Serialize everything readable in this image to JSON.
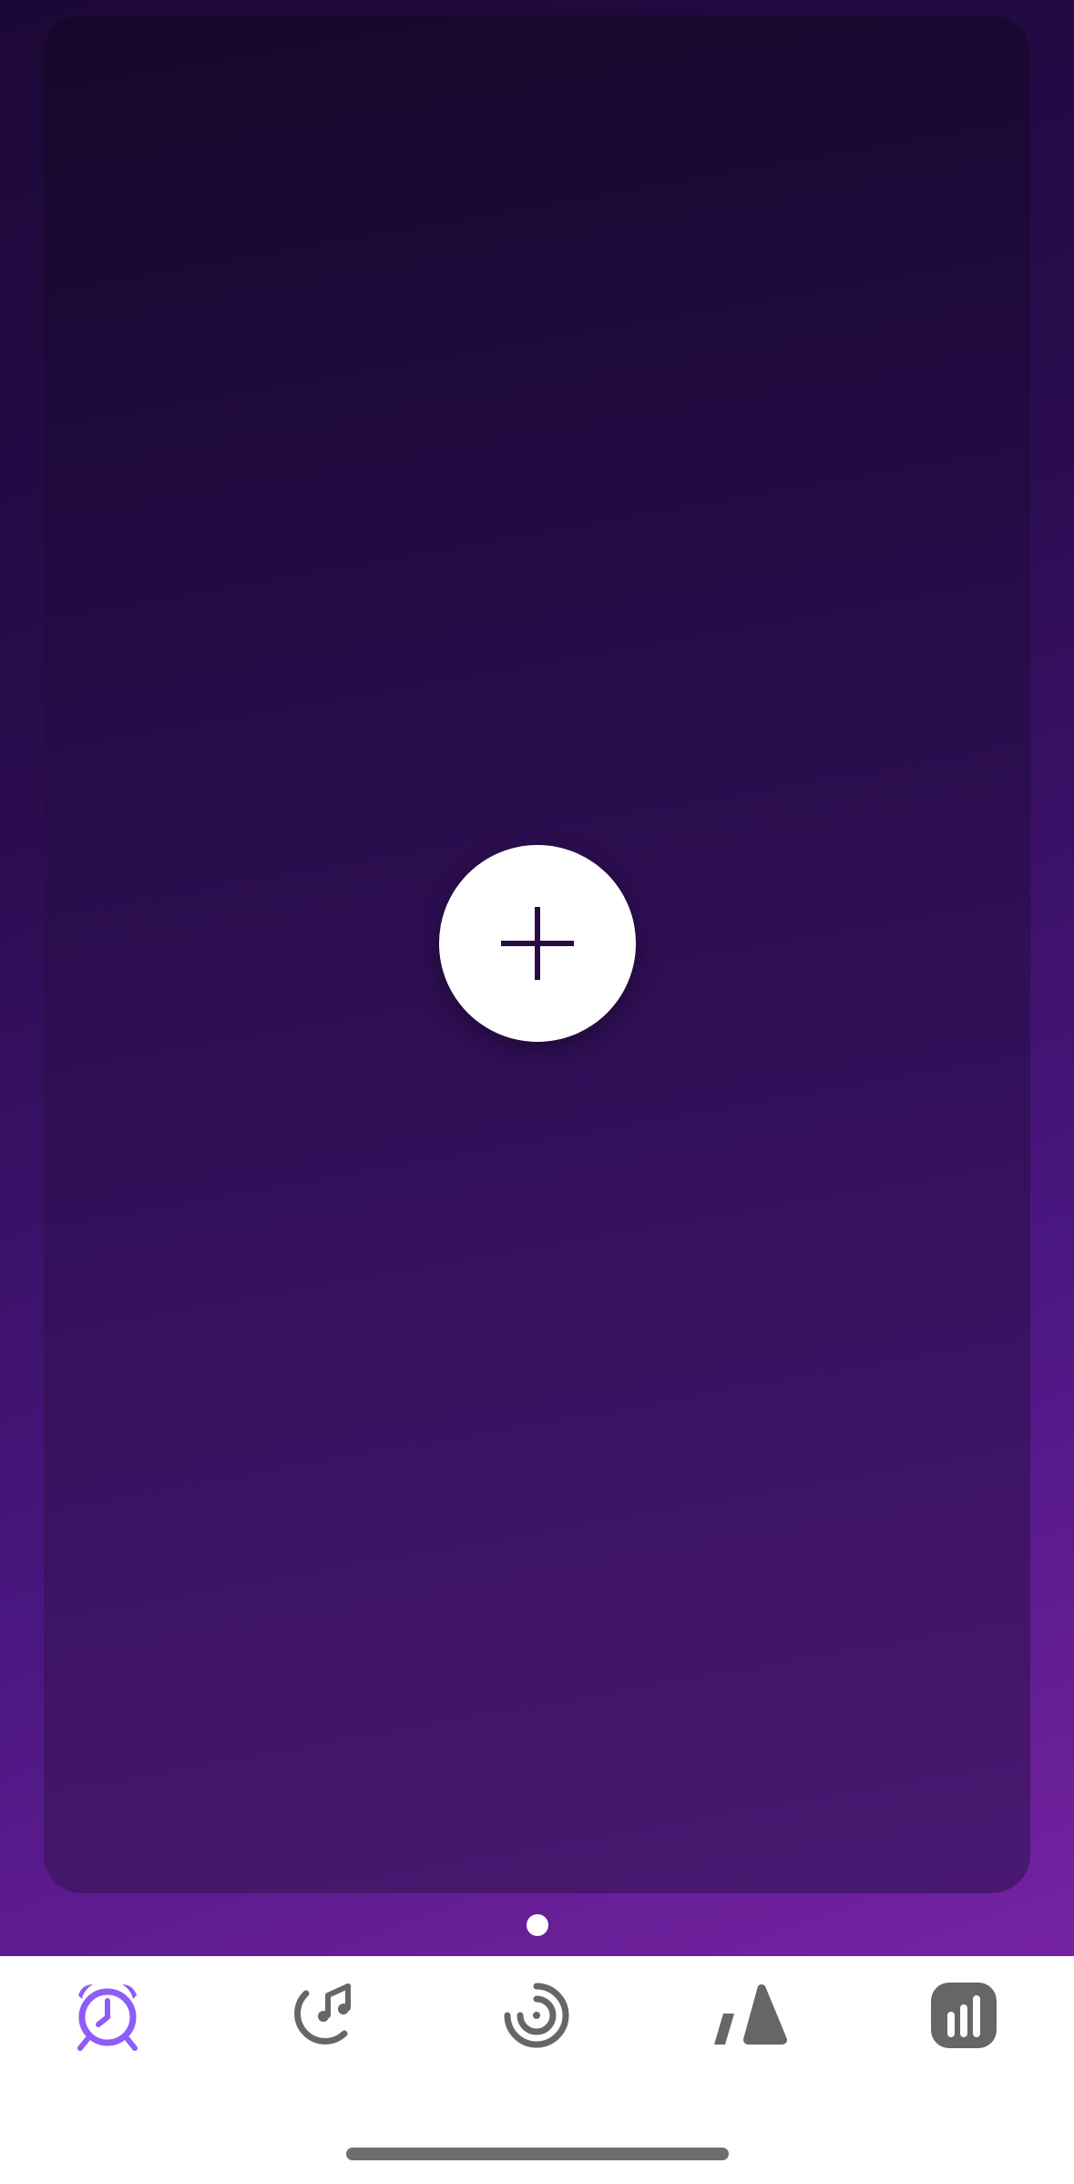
{
  "colors": {
    "accent": "#8e5cf7",
    "inactive_icon": "#666666",
    "add_button_bg": "#ffffff",
    "add_button_icon": "#2a0c45",
    "nav_bg": "#ffffff"
  },
  "main": {
    "add_button": {
      "icon": "plus-icon"
    },
    "pager": {
      "page_count": 1,
      "current_page": 1
    }
  },
  "bottom_nav": {
    "items": [
      {
        "icon": "alarm-clock-icon",
        "active": true
      },
      {
        "icon": "sleep-sounds-icon",
        "active": false
      },
      {
        "icon": "timer-spiral-icon",
        "active": false
      },
      {
        "icon": "metronome-icon",
        "active": false
      },
      {
        "icon": "stats-icon",
        "active": false
      }
    ]
  }
}
